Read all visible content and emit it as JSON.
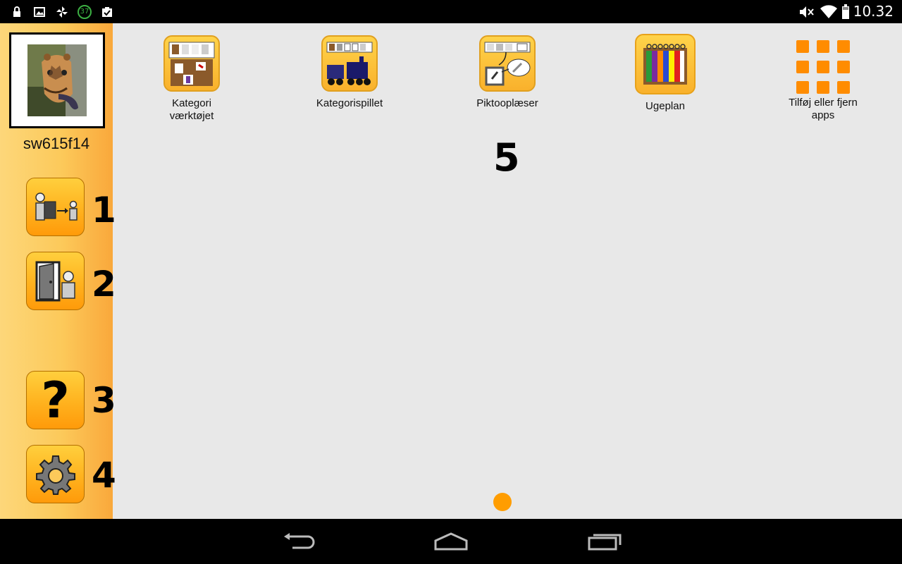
{
  "status_bar": {
    "time": "10.32",
    "notification_badge": "37",
    "icons": [
      "lock-icon",
      "image-icon",
      "pinwheel-icon",
      "notification-badge-icon",
      "clipboard-check-icon",
      "mute-icon",
      "wifi-icon",
      "battery-icon"
    ]
  },
  "sidebar": {
    "username": "sw615f14",
    "buttons": [
      {
        "icon": "switch-profile-icon",
        "number": "1"
      },
      {
        "icon": "logout-door-icon",
        "number": "2"
      },
      {
        "icon": "help-icon",
        "number": "3"
      },
      {
        "icon": "settings-gear-icon",
        "number": "4"
      }
    ]
  },
  "apps": [
    {
      "label": "Kategori værktøjet",
      "icon": "category-tool-icon"
    },
    {
      "label": "Kategorispillet",
      "icon": "category-game-train-icon"
    },
    {
      "label": "Piktooplæser",
      "icon": "pictogram-reader-icon"
    },
    {
      "label": "Ugeplan",
      "icon": "weekly-plan-icon"
    },
    {
      "label": "Tilføj eller fjern apps",
      "icon": "grid-apps-icon"
    }
  ],
  "annotation": "5",
  "colors": {
    "accent": "#ff9d00",
    "sidebar": "#fcc95a",
    "background": "#e8e8e8"
  }
}
